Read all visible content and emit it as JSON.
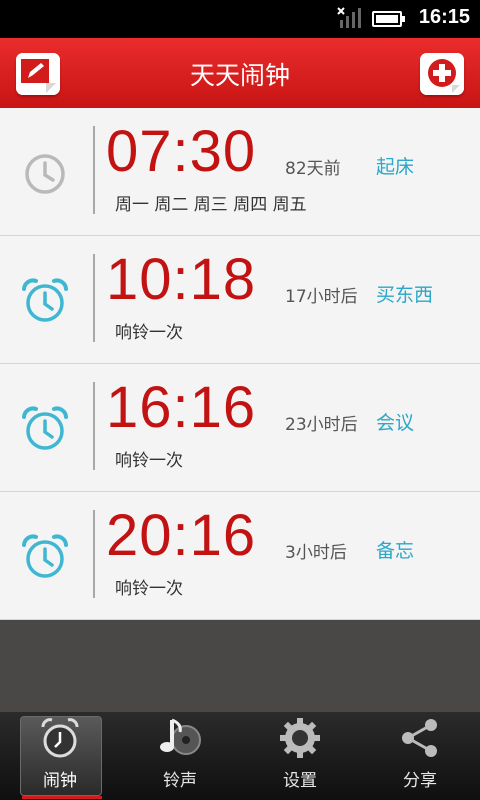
{
  "status": {
    "time": "16:15"
  },
  "header": {
    "title": "天天闹钟",
    "edit_icon": "edit-icon",
    "add_icon": "add-icon"
  },
  "alarms": [
    {
      "time": "07:30",
      "relative": "82天前",
      "label": "起床",
      "repeat": "周一 周二 周三 周四 周五",
      "enabled": false
    },
    {
      "time": "10:18",
      "relative": "17小时后",
      "label": "买东西",
      "repeat": "响铃一次",
      "enabled": true
    },
    {
      "time": "16:16",
      "relative": "23小时后",
      "label": "会议",
      "repeat": "响铃一次",
      "enabled": true
    },
    {
      "time": "20:16",
      "relative": "3小时后",
      "label": "备忘",
      "repeat": "响铃一次",
      "enabled": true
    }
  ],
  "tabs": [
    {
      "label": "闹钟",
      "icon": "alarm-clock-icon",
      "active": true
    },
    {
      "label": "铃声",
      "icon": "music-note-icon",
      "active": false
    },
    {
      "label": "设置",
      "icon": "gear-icon",
      "active": false
    },
    {
      "label": "分享",
      "icon": "share-icon",
      "active": false
    }
  ],
  "colors": {
    "accent": "#d21b1b",
    "time_red": "#c21212",
    "label_blue": "#2aa7c9",
    "icon_enabled": "#3fb6d2",
    "icon_disabled": "#b9b9b9"
  }
}
